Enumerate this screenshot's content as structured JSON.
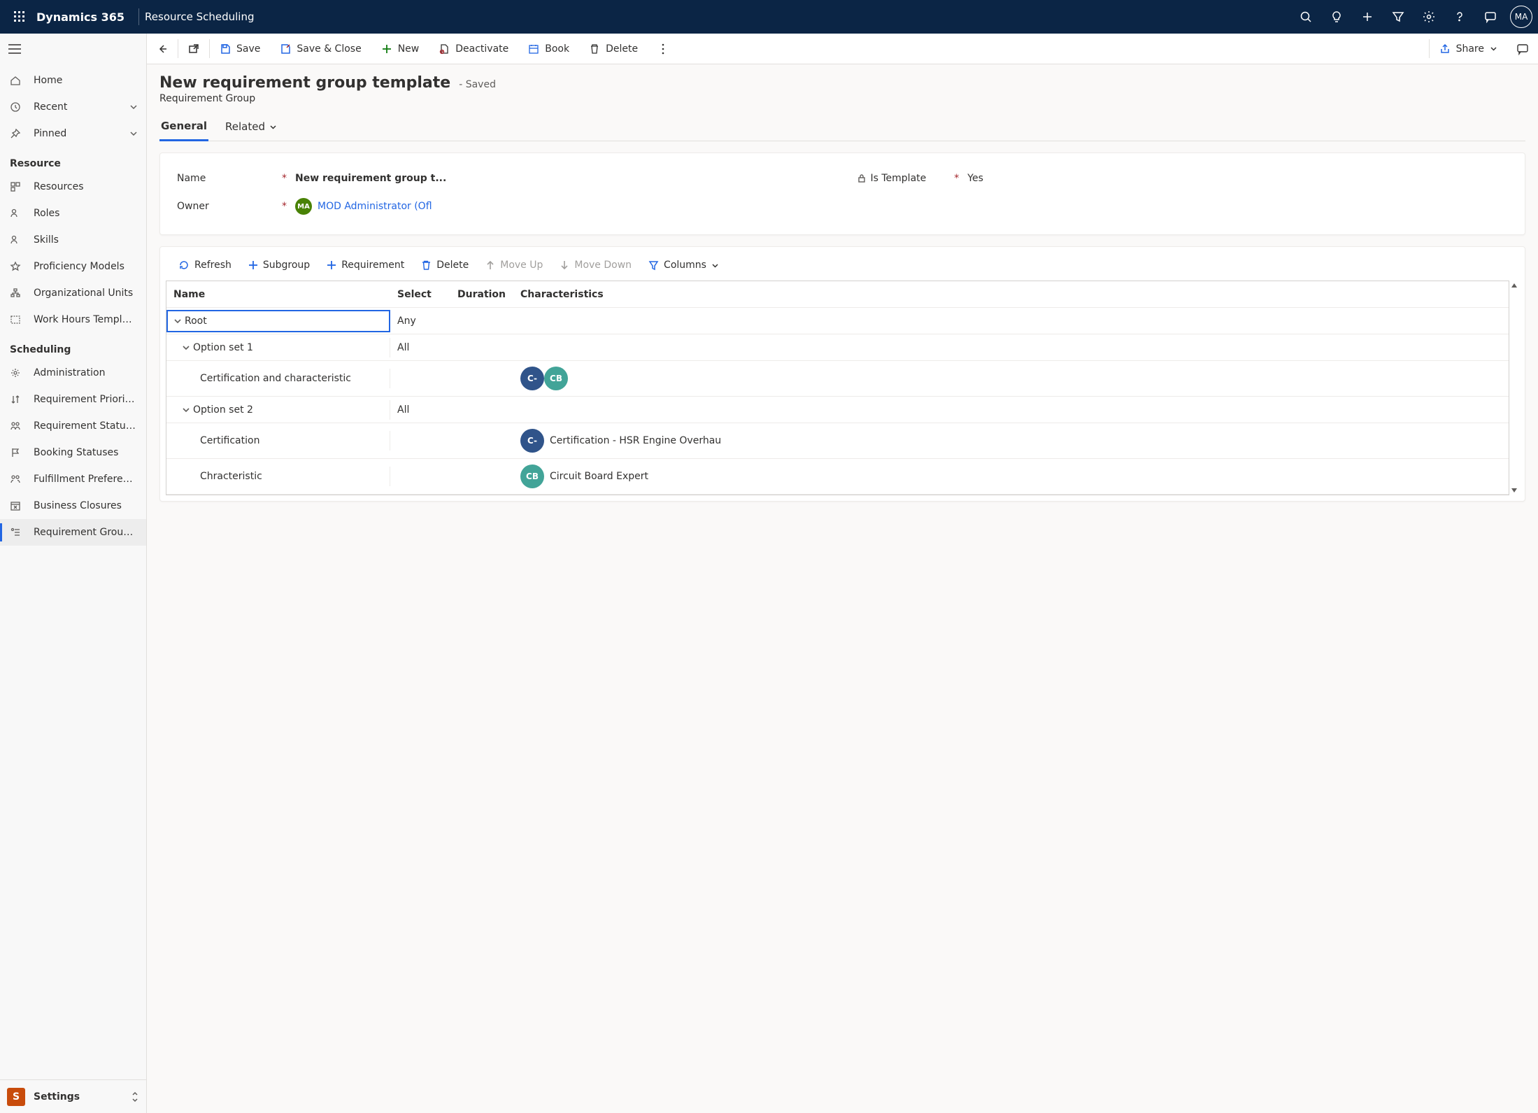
{
  "topbar": {
    "brand": "Dynamics 365",
    "app": "Resource Scheduling",
    "avatar": "MA"
  },
  "sidebar": {
    "main_items": [
      {
        "label": "Home",
        "icon": "home",
        "chev": false
      },
      {
        "label": "Recent",
        "icon": "clock",
        "chev": true
      },
      {
        "label": "Pinned",
        "icon": "pin",
        "chev": true
      }
    ],
    "section1": "Resource",
    "resource_items": [
      {
        "label": "Resources",
        "icon": "resources"
      },
      {
        "label": "Roles",
        "icon": "person"
      },
      {
        "label": "Skills",
        "icon": "person"
      },
      {
        "label": "Proficiency Models",
        "icon": "star"
      },
      {
        "label": "Organizational Units",
        "icon": "org"
      },
      {
        "label": "Work Hours Templates",
        "icon": "calendar-dots"
      }
    ],
    "section2": "Scheduling",
    "sched_items": [
      {
        "label": "Administration",
        "icon": "gear"
      },
      {
        "label": "Requirement Priorities",
        "icon": "sort"
      },
      {
        "label": "Requirement Statuses",
        "icon": "group"
      },
      {
        "label": "Booking Statuses",
        "icon": "flag"
      },
      {
        "label": "Fulfillment Preferences",
        "icon": "group"
      },
      {
        "label": "Business Closures",
        "icon": "closed"
      },
      {
        "label": "Requirement Group ...",
        "icon": "reqgroup",
        "active": true
      }
    ],
    "switcher": {
      "badge": "S",
      "label": "Settings"
    }
  },
  "commands": {
    "save": "Save",
    "saveClose": "Save & Close",
    "new": "New",
    "deactivate": "Deactivate",
    "book": "Book",
    "delete": "Delete",
    "share": "Share"
  },
  "header": {
    "title": "New requirement group template",
    "status": "- Saved",
    "entity": "Requirement Group"
  },
  "tabs": {
    "general": "General",
    "related": "Related"
  },
  "form": {
    "nameLabel": "Name",
    "nameValue": "New requirement group t...",
    "templLabel": "Is Template",
    "templValue": "Yes",
    "ownerLabel": "Owner",
    "ownerValue": "MOD Administrator (Ofl",
    "ownerCoin": "MA"
  },
  "gridbar": {
    "refresh": "Refresh",
    "subgroup": "Subgroup",
    "requirement": "Requirement",
    "delete": "Delete",
    "moveUp": "Move Up",
    "moveDown": "Move Down",
    "columns": "Columns"
  },
  "grid": {
    "headers": {
      "name": "Name",
      "select": "Select",
      "duration": "Duration",
      "char": "Characteristics"
    },
    "rows": [
      {
        "indent": 0,
        "name": "Root",
        "expand": true,
        "select": "Any",
        "selected": true
      },
      {
        "indent": 1,
        "name": "Option set 1",
        "expand": true,
        "select": "All"
      },
      {
        "indent": 2,
        "name": "Certification and characteristic",
        "chips": [
          {
            "c": "blue",
            "t": "C-"
          },
          {
            "c": "teal",
            "t": "CB",
            "overlap": true
          }
        ]
      },
      {
        "indent": 1,
        "name": "Option set 2",
        "expand": true,
        "select": "All"
      },
      {
        "indent": 2,
        "name": "Certification",
        "chips": [
          {
            "c": "blue",
            "t": "C-"
          }
        ],
        "charText": "Certification - HSR Engine Overhau"
      },
      {
        "indent": 2,
        "name": "Chracteristic",
        "chips": [
          {
            "c": "teal",
            "t": "CB"
          }
        ],
        "charText": "Circuit Board Expert"
      }
    ]
  }
}
